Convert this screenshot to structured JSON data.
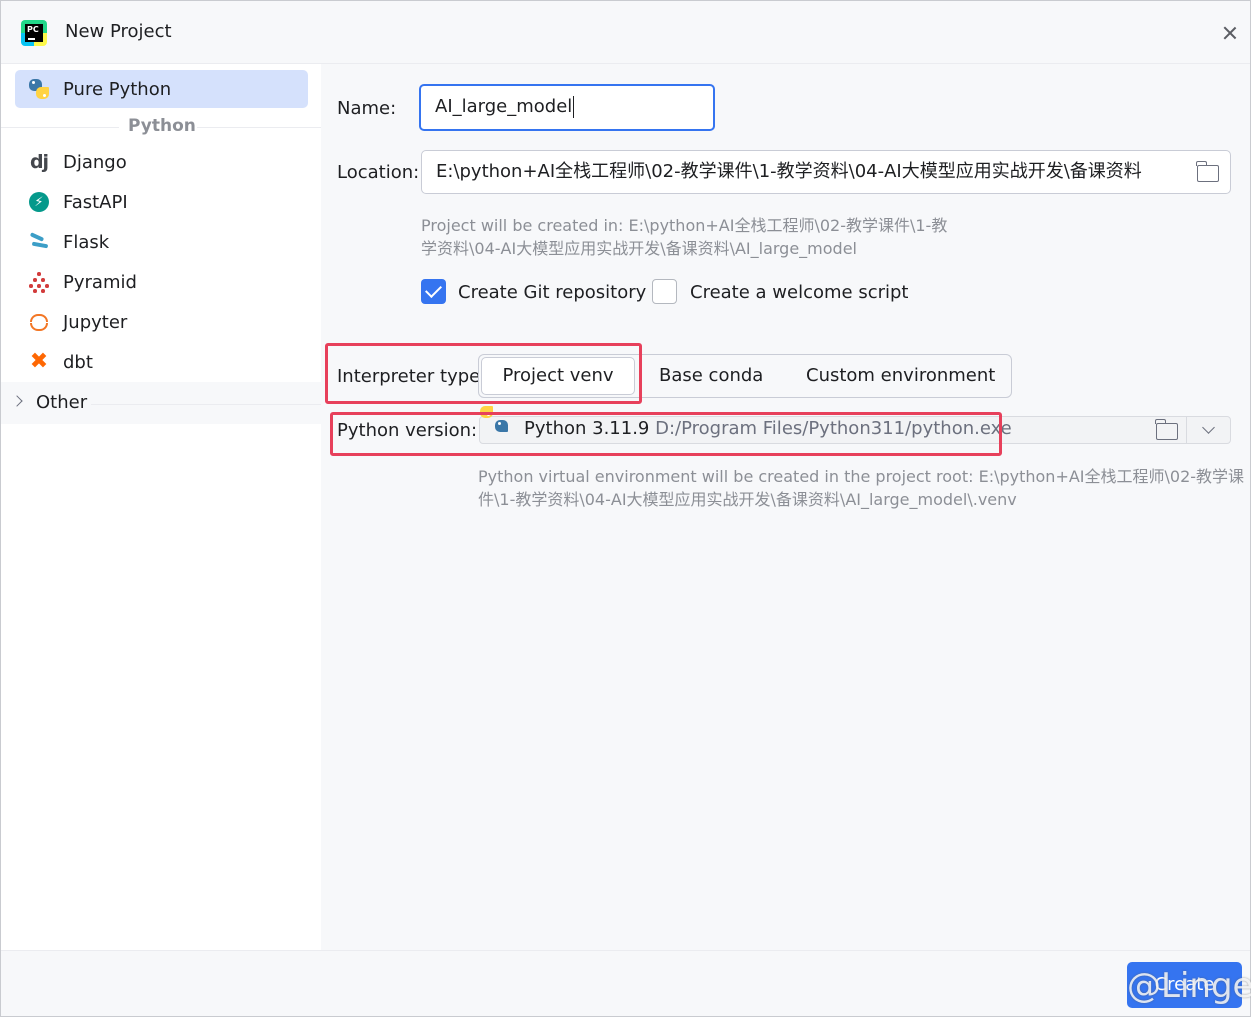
{
  "window": {
    "title": "New Project",
    "app_logo_text": "PC"
  },
  "sidebar": {
    "items": [
      {
        "label": "Pure Python",
        "icon": "python-icon",
        "selected": true
      },
      {
        "label": "Django",
        "icon": "django-icon",
        "glyph": "dj"
      },
      {
        "label": "FastAPI",
        "icon": "fastapi-icon",
        "glyph": "⚡"
      },
      {
        "label": "Flask",
        "icon": "flask-icon"
      },
      {
        "label": "Pyramid",
        "icon": "pyramid-icon"
      },
      {
        "label": "Jupyter",
        "icon": "jupyter-icon"
      },
      {
        "label": "dbt",
        "icon": "dbt-icon",
        "glyph": "✖"
      }
    ],
    "group_label": "Python",
    "other_label": "Other"
  },
  "form": {
    "name_label": "Name:",
    "name_value": "AI_large_model",
    "location_label": "Location:",
    "location_value": "E:\\python+AI全栈工程师\\02-教学课件\\1-教学资料\\04-AI大模型应用实战开发\\备课资料",
    "created_hint_line1": "Project will be created in: E:\\python+AI全栈工程师\\02-教学课件\\1-教",
    "created_hint_line2": "学资料\\04-AI大模型应用实战开发\\备课资料\\AI_large_model",
    "git_label": "Create Git repository",
    "git_checked": true,
    "welcome_label": "Create a welcome script",
    "welcome_checked": false,
    "interpreter_label": "Interpreter type:",
    "interpreter_options": [
      "Project venv",
      "Base conda",
      "Custom environment"
    ],
    "interpreter_selected": "Project venv",
    "python_version_label": "Python version:",
    "python_version_name": "Python 3.11.9",
    "python_version_path": "D:/Program Files/Python311/python.exe",
    "venv_hint_line1": "Python virtual environment will be created in the project root: E:\\python+AI全栈工程师\\02-教学课",
    "venv_hint_line2": "件\\1-教学资料\\04-AI大模型应用实战开发\\备课资料\\AI_large_model\\.venv"
  },
  "footer": {
    "create_label": "Create",
    "watermark": "@Linge"
  },
  "colors": {
    "accent": "#3574f0",
    "selection": "#d5e1fc",
    "highlight_box": "#e7405b"
  }
}
